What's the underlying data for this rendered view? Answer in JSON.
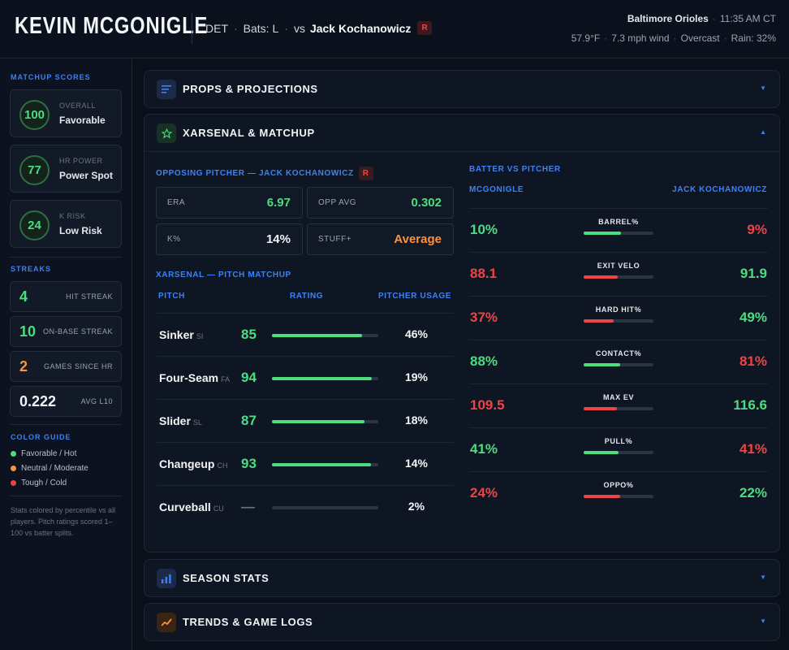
{
  "header": {
    "player_name": "KEVIN MCGONIGLE",
    "team": "DET",
    "bats": "Bats: L",
    "vs": "vs",
    "opponent": "Jack Kochanowicz",
    "hand_badge": "R",
    "venue_team": "Baltimore Orioles",
    "time": "11:35 AM CT",
    "temp": "57.9°F",
    "wind": "7.3 mph wind",
    "sky": "Overcast",
    "rain": "Rain: 32%"
  },
  "sidebar": {
    "matchup_title": "MATCHUP SCORES",
    "scores": [
      {
        "value": "100",
        "label": "OVERALL",
        "text": "Favorable"
      },
      {
        "value": "77",
        "label": "HR POWER",
        "text": "Power Spot"
      },
      {
        "value": "24",
        "label": "K RISK",
        "text": "Low Risk"
      }
    ],
    "streaks_title": "STREAKS",
    "streaks": [
      {
        "value": "4",
        "label": "HIT STREAK",
        "color": "#4ade80"
      },
      {
        "value": "10",
        "label": "ON-BASE STREAK",
        "color": "#4ade80"
      },
      {
        "value": "2",
        "label": "GAMES SINCE HR",
        "color": "#fb923c"
      },
      {
        "value": "0.222",
        "label": "AVG L10",
        "color": "#f3f4f6"
      }
    ],
    "color_guide_title": "COLOR GUIDE",
    "legend": [
      {
        "label": "Favorable / Hot",
        "color": "#4ade80"
      },
      {
        "label": "Neutral / Moderate",
        "color": "#fb923c"
      },
      {
        "label": "Tough / Cold",
        "color": "#ef4444"
      }
    ],
    "note": "Stats colored by percentile vs all players. Pitch ratings scored 1–100 vs batter splits."
  },
  "panels": {
    "props": "PROPS & PROJECTIONS",
    "xarsenal": "XARSENAL & MATCHUP",
    "season": "SEASON STATS",
    "trends": "TRENDS & GAME LOGS"
  },
  "pitcher": {
    "title": "OPPOSING PITCHER — JACK KOCHANOWICZ",
    "badge": "R",
    "stats": [
      {
        "label": "ERA",
        "value": "6.97",
        "color": "#4ade80"
      },
      {
        "label": "OPP AVG",
        "value": "0.302",
        "color": "#4ade80"
      },
      {
        "label": "K%",
        "value": "14%",
        "color": "#f3f4f6"
      },
      {
        "label": "STUFF+",
        "value": "Average",
        "color": "#fb923c"
      }
    ]
  },
  "pitch_matchup": {
    "title": "XARSENAL — PITCH MATCHUP",
    "col_pitch": "PITCH",
    "col_rating": "RATING",
    "col_usage": "PITCHER USAGE",
    "rows": [
      {
        "name": "Sinker",
        "code": "SI",
        "rating": "85",
        "rating_pct": 85,
        "usage": "46%"
      },
      {
        "name": "Four-Seam",
        "code": "FA",
        "rating": "94",
        "rating_pct": 94,
        "usage": "19%"
      },
      {
        "name": "Slider",
        "code": "SL",
        "rating": "87",
        "rating_pct": 87,
        "usage": "18%"
      },
      {
        "name": "Changeup",
        "code": "CH",
        "rating": "93",
        "rating_pct": 93,
        "usage": "14%"
      },
      {
        "name": "Curveball",
        "code": "CU",
        "rating": "—",
        "rating_pct": 0,
        "usage": "2%"
      }
    ]
  },
  "bvp": {
    "title": "BATTER VS PITCHER",
    "batter": "MCGONIGLE",
    "pitcher": "JACK KOCHANOWICZ",
    "rows": [
      {
        "label": "BARREL%",
        "left": "10%",
        "right": "9%",
        "left_color": "#4ade80",
        "right_color": "#ef4444",
        "bar_pct": 53,
        "bar_color": "#4ade80"
      },
      {
        "label": "EXIT VELO",
        "left": "88.1",
        "right": "91.9",
        "left_color": "#ef4444",
        "right_color": "#4ade80",
        "bar_pct": 49,
        "bar_color": "#ef4444"
      },
      {
        "label": "HARD HIT%",
        "left": "37%",
        "right": "49%",
        "left_color": "#ef4444",
        "right_color": "#4ade80",
        "bar_pct": 43,
        "bar_color": "#ef4444"
      },
      {
        "label": "CONTACT%",
        "left": "88%",
        "right": "81%",
        "left_color": "#4ade80",
        "right_color": "#ef4444",
        "bar_pct": 52,
        "bar_color": "#4ade80"
      },
      {
        "label": "MAX EV",
        "left": "109.5",
        "right": "116.6",
        "left_color": "#ef4444",
        "right_color": "#4ade80",
        "bar_pct": 48,
        "bar_color": "#ef4444"
      },
      {
        "label": "PULL%",
        "left": "41%",
        "right": "41%",
        "left_color": "#4ade80",
        "right_color": "#ef4444",
        "bar_pct": 50,
        "bar_color": "#4ade80"
      },
      {
        "label": "OPPO%",
        "left": "24%",
        "right": "22%",
        "left_color": "#ef4444",
        "right_color": "#4ade80",
        "bar_pct": 52,
        "bar_color": "#ef4444"
      }
    ]
  }
}
